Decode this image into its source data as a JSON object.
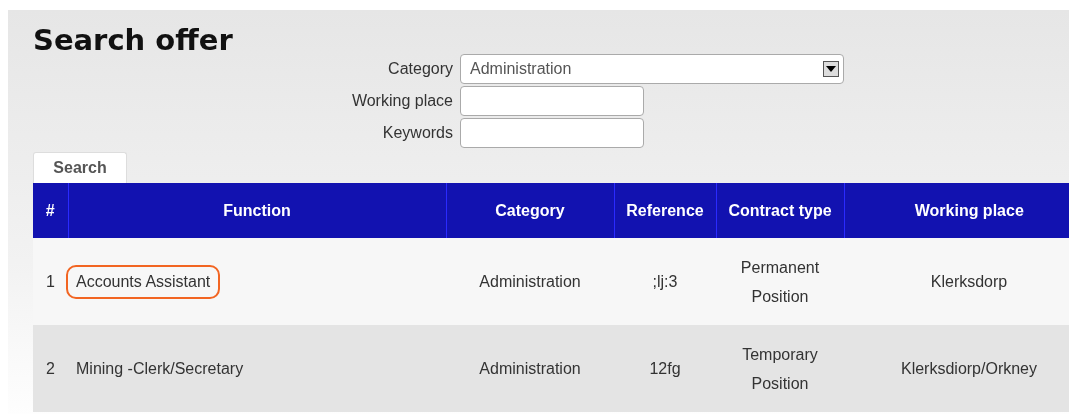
{
  "title": "Search offer",
  "form": {
    "fields": [
      {
        "kind": "select",
        "label": "Category",
        "value": "Administration"
      },
      {
        "kind": "text",
        "label": "Working place"
      },
      {
        "kind": "text",
        "label": "Keywords"
      }
    ],
    "button": "Search"
  },
  "table": {
    "columns": [
      "#",
      "Function",
      "Category",
      "Reference",
      "Contract type",
      "Working place"
    ],
    "rows": [
      {
        "cells": [
          "1",
          "Accounts Assistant",
          "Administration",
          ";lj:3",
          "Permanent Position",
          "Klerksdorp"
        ],
        "highlighted": true
      },
      {
        "cells": [
          "2",
          "Mining -Clerk/Secretary",
          "Administration",
          "12fg",
          "Temporary Position",
          "Klerksdiorp/Orkney"
        ],
        "highlighted": false
      }
    ]
  }
}
